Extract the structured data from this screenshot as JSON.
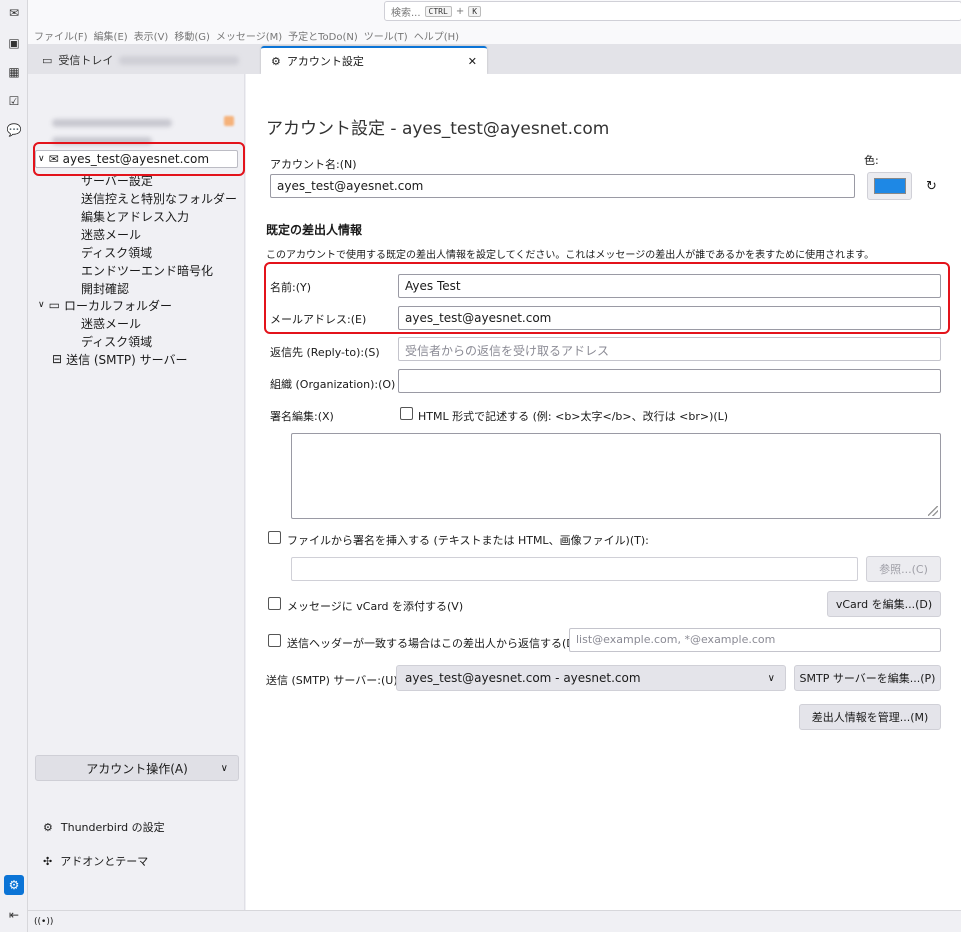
{
  "search": {
    "placeholder": "検索...",
    "key1": "CTRL",
    "plus": "+",
    "key2": "K"
  },
  "menu": [
    "ファイル(F)",
    "編集(E)",
    "表示(V)",
    "移動(G)",
    "メッセージ(M)",
    "予定とToDo(N)",
    "ツール(T)",
    "ヘルプ(H)"
  ],
  "tabs": {
    "inbox": "受信トレイ",
    "settings": "アカウント設定",
    "close": "✕"
  },
  "tree": {
    "account": "ayes_test@ayesnet.com",
    "children": [
      "サーバー設定",
      "送信控えと特別なフォルダー",
      "編集とアドレス入力",
      "迷惑メール",
      "ディスク領域",
      "エンドツーエンド暗号化",
      "開封確認"
    ],
    "local": "ローカルフォルダー",
    "local_children": [
      "迷惑メール",
      "ディスク領域"
    ],
    "smtp": "送信 (SMTP) サーバー"
  },
  "left_footer": {
    "account_actions": "アカウント操作(A)",
    "tb_settings": "Thunderbird の設定",
    "addons": "アドオンとテーマ"
  },
  "main": {
    "heading": "アカウント設定 - ayes_test@ayesnet.com",
    "account_name_label": "アカウント名:(N)",
    "account_name_value": "ayes_test@ayesnet.com",
    "color_label": "色:",
    "section_title": "既定の差出人情報",
    "section_desc": "このアカウントで使用する既定の差出人情報を設定してください。これはメッセージの差出人が誰であるかを表すために使用されます。",
    "name_label": "名前:(Y)",
    "name_value": "Ayes Test",
    "email_label": "メールアドレス:(E)",
    "email_value": "ayes_test@ayesnet.com",
    "replyto_label": "返信先 (Reply-to):(S)",
    "replyto_placeholder": "受信者からの返信を受け取るアドレス",
    "org_label": "組織 (Organization):(O)",
    "org_value": "",
    "sig_label": "署名編集:(X)",
    "html_sig_label": "HTML 形式で記述する (例: <b>太字</b>、改行は <br>)(L)",
    "file_sig_label": "ファイルから署名を挿入する (テキストまたは HTML、画像ファイル)(T):",
    "browse_btn": "参照...(C)",
    "vcard_label": "メッセージに vCard を添付する(V)",
    "vcard_btn": "vCard を編集...(D)",
    "reply_header_label": "送信ヘッダーが一致する場合はこの差出人から返信する(D):",
    "reply_header_placeholder": "list@example.com, *@example.com",
    "smtp_label": "送信 (SMTP) サーバー:(U)",
    "smtp_value": "ayes_test@ayesnet.com - ayesnet.com",
    "smtp_btn": "SMTP サーバーを編集...(P)",
    "identities_btn": "差出人情報を管理...(M)",
    "account_color": "#1e88e5"
  }
}
